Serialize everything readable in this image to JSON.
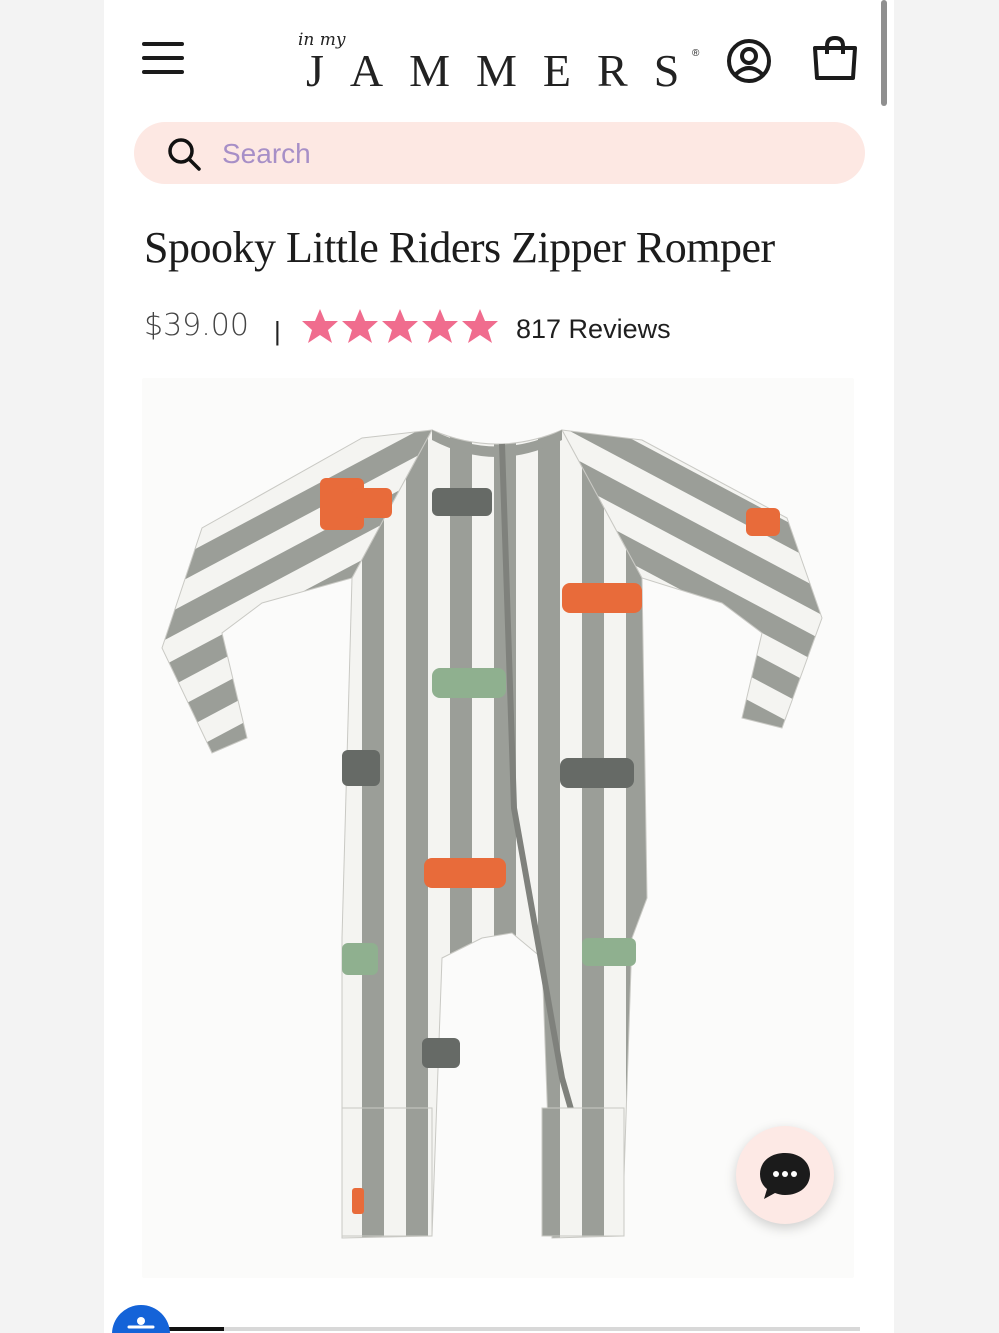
{
  "header": {
    "logo_small": "in my",
    "logo_main": "JAMMERS",
    "logo_reg": "®"
  },
  "search": {
    "placeholder": "Search"
  },
  "product": {
    "title": "Spooky Little Riders Zipper Romper",
    "price": "$39.00",
    "divider": "|",
    "rating": 5,
    "reviews": "817 Reviews"
  },
  "colors": {
    "star": "#f06c8e",
    "search_bg": "#fde8e3",
    "placeholder": "#a78fc7",
    "stripe_gray": "#9b9e98",
    "chat_bg": "#fde9e5",
    "a11y_blue": "#1463d8"
  },
  "icons": {
    "menu": "hamburger-menu-icon",
    "account": "user-circle-icon",
    "cart": "shopping-bag-icon",
    "search": "magnifier-icon",
    "chat": "chat-bubble-icon",
    "accessibility": "accessibility-icon"
  }
}
